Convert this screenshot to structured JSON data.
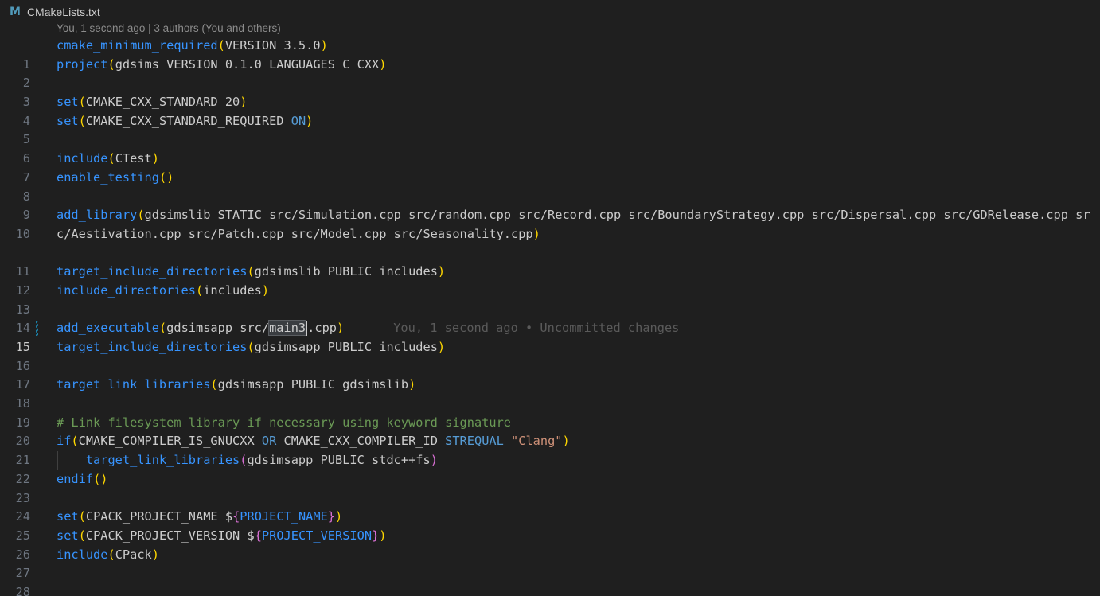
{
  "tab": {
    "icon": "cmake-icon",
    "icon_glyph": "M",
    "filename": "CMakeLists.txt"
  },
  "blame_header": "You, 1 second ago | 3 authors (You and others)",
  "inline_blame": "You, 1 second ago • Uncommitted changes",
  "line_numbers": [
    "1",
    "2",
    "3",
    "4",
    "5",
    "6",
    "7",
    "8",
    "9",
    "10",
    "11",
    "12",
    "13",
    "14",
    "15",
    "16",
    "17",
    "18",
    "19",
    "20",
    "21",
    "22",
    "23",
    "24",
    "25",
    "26",
    "27",
    "28"
  ],
  "active_line": "15",
  "code": {
    "l1": [
      "cmake_minimum_required",
      "(",
      "VERSION 3.5.0",
      ")"
    ],
    "l2": [
      "project",
      "(",
      "gdsims VERSION 0.1.0 LANGUAGES C CXX",
      ")"
    ],
    "l4": [
      "set",
      "(",
      "CMAKE_CXX_STANDARD 20",
      ")"
    ],
    "l5": [
      "set",
      "(",
      "CMAKE_CXX_STANDARD_REQUIRED ",
      "ON",
      ")"
    ],
    "l7": [
      "include",
      "(",
      "CTest",
      ")"
    ],
    "l8": [
      "enable_testing",
      "(",
      ")"
    ],
    "l10": [
      "add_library",
      "(",
      "gdsimslib STATIC src/Simulation.cpp src/random.cpp src/Record.cpp src/BoundaryStrategy.cpp src/Dispersal.cpp src/GDRelease.cpp src/Aestivation.cpp src/Patch.cpp src/Model.cpp src/Seasonality.cpp",
      ")"
    ],
    "l12": [
      "target_include_directories",
      "(",
      "gdsimslib PUBLIC includes",
      ")"
    ],
    "l13": [
      "include_directories",
      "(",
      "includes",
      ")"
    ],
    "l15": [
      "add_executable",
      "(",
      "gdsimsapp src/",
      "main3",
      ".cpp",
      ")"
    ],
    "l16": [
      "target_include_directories",
      "(",
      "gdsimsapp PUBLIC includes",
      ")"
    ],
    "l18": [
      "target_link_libraries",
      "(",
      "gdsimsapp PUBLIC gdsimslib",
      ")"
    ],
    "l20": [
      "# Link filesystem library if necessary using keyword signature"
    ],
    "l21": [
      "if",
      "(",
      "CMAKE_COMPILER_IS_GNUCXX ",
      "OR",
      " CMAKE_CXX_COMPILER_ID ",
      "STREQUAL",
      " ",
      "\"Clang\"",
      ")"
    ],
    "l22": [
      "    ",
      "target_link_libraries",
      "(",
      "gdsimsapp PUBLIC stdc++fs",
      ")"
    ],
    "l23": [
      "endif",
      "(",
      ")"
    ],
    "l25": [
      "set",
      "(",
      "CPACK_PROJECT_NAME $",
      "{",
      "PROJECT_NAME",
      "}",
      ")"
    ],
    "l26": [
      "set",
      "(",
      "CPACK_PROJECT_VERSION $",
      "{",
      "PROJECT_VERSION",
      "}",
      ")"
    ],
    "l27": [
      "include",
      "(",
      "CPack",
      ")"
    ]
  }
}
